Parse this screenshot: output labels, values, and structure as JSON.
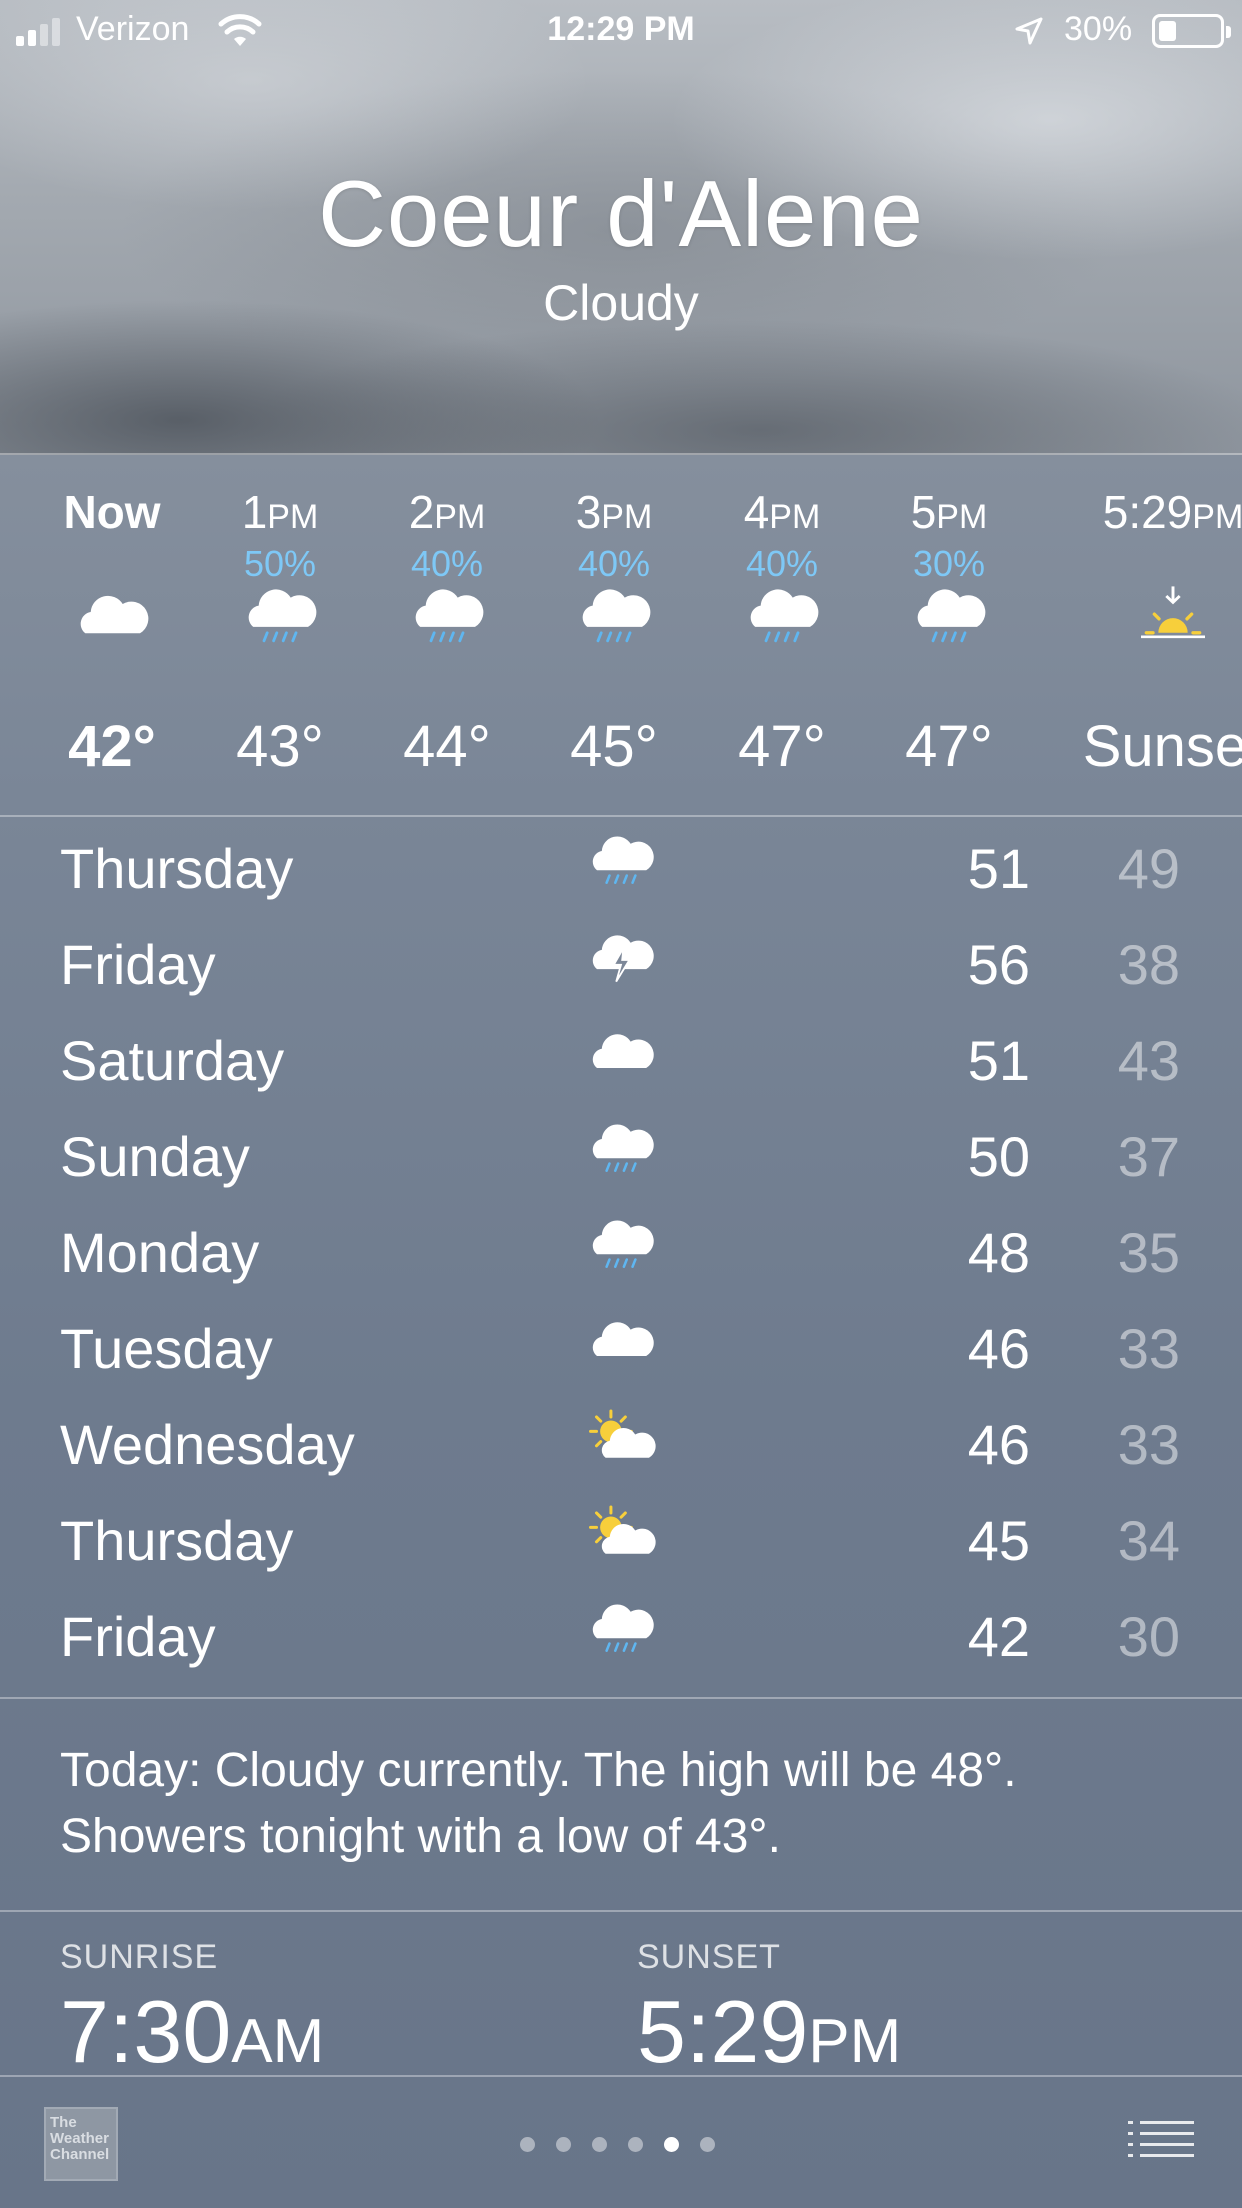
{
  "status_bar": {
    "carrier": "Verizon",
    "time": "12:29 PM",
    "battery": "30%",
    "battery_level": 0.3,
    "icons": [
      "signal-icon",
      "wifi-icon",
      "location-arrow-icon",
      "battery-icon"
    ]
  },
  "location": {
    "city": "Coeur d'Alene",
    "condition": "Cloudy"
  },
  "hourly": [
    {
      "label": "Now",
      "suffix": "",
      "precip": "",
      "icon": "cloud-icon",
      "temp": "42°"
    },
    {
      "label": "1",
      "suffix": "PM",
      "precip": "50%",
      "icon": "rain-cloud-icon",
      "temp": "43°"
    },
    {
      "label": "2",
      "suffix": "PM",
      "precip": "40%",
      "icon": "rain-cloud-icon",
      "temp": "44°"
    },
    {
      "label": "3",
      "suffix": "PM",
      "precip": "40%",
      "icon": "rain-cloud-icon",
      "temp": "45°"
    },
    {
      "label": "4",
      "suffix": "PM",
      "precip": "40%",
      "icon": "rain-cloud-icon",
      "temp": "47°"
    },
    {
      "label": "5",
      "suffix": "PM",
      "precip": "30%",
      "icon": "rain-cloud-icon",
      "temp": "47°"
    },
    {
      "label": "5:29",
      "suffix": "PM",
      "precip": "",
      "icon": "sunset-icon",
      "temp": "Sunset"
    }
  ],
  "daily": [
    {
      "day": "Thursday",
      "icon": "rain-cloud-icon",
      "high": "51",
      "low": "49"
    },
    {
      "day": "Friday",
      "icon": "thunderstorm-icon",
      "high": "56",
      "low": "38"
    },
    {
      "day": "Saturday",
      "icon": "cloud-icon",
      "high": "51",
      "low": "43"
    },
    {
      "day": "Sunday",
      "icon": "rain-cloud-icon",
      "high": "50",
      "low": "37"
    },
    {
      "day": "Monday",
      "icon": "rain-cloud-icon",
      "high": "48",
      "low": "35"
    },
    {
      "day": "Tuesday",
      "icon": "cloud-icon",
      "high": "46",
      "low": "33"
    },
    {
      "day": "Wednesday",
      "icon": "partly-sunny-icon",
      "high": "46",
      "low": "33"
    },
    {
      "day": "Thursday",
      "icon": "partly-sunny-icon",
      "high": "45",
      "low": "34"
    },
    {
      "day": "Friday",
      "icon": "rain-cloud-icon",
      "high": "42",
      "low": "30"
    }
  ],
  "summary": {
    "line1": "Today: Cloudy currently. The high will be 48°.",
    "line2": "Showers tonight with a low of 43°."
  },
  "sun": {
    "sunrise_label": "SUNRISE",
    "sunrise_time": "7:30",
    "sunrise_suffix": "AM",
    "sunset_label": "SUNSET",
    "sunset_time": "5:29",
    "sunset_suffix": "PM"
  },
  "footer": {
    "logo_line1": "The",
    "logo_line2": "Weather",
    "logo_line3": "Channel",
    "page_count": 6,
    "active_page": 5
  },
  "colors": {
    "precip_blue": "#7ec8f6",
    "sun_yellow": "#f7cf3b",
    "rain_blue": "#5fb6f0"
  }
}
